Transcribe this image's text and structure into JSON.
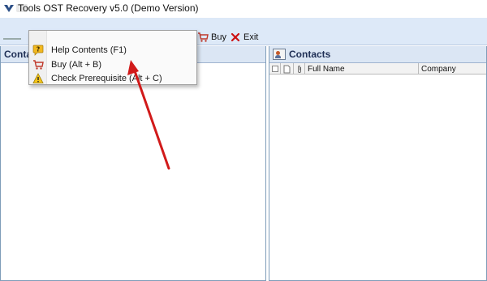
{
  "window": {
    "title": "Tools OST Recovery v5.0 (Demo Version)"
  },
  "toolbar": {
    "buy_label": "Buy",
    "exit_label": "Exit"
  },
  "left_pane": {
    "header": "Conta"
  },
  "right_pane": {
    "header": "Contacts",
    "columns": [
      "Full Name",
      "Company"
    ]
  },
  "help_menu": {
    "items": [
      {
        "label": "Help Contents (F1)",
        "icon": "help-icon"
      },
      {
        "label": "Buy (Alt + B)",
        "icon": "cart-icon"
      },
      {
        "label": "Check Prerequisite (Alt + C)",
        "icon": "warning-icon"
      }
    ]
  },
  "colors": {
    "toolbar_bg": "#dde9f8",
    "pane_header_bg": "#dbe6f4",
    "arrow": "#d11a1a",
    "exit_x": "#cc1111"
  }
}
